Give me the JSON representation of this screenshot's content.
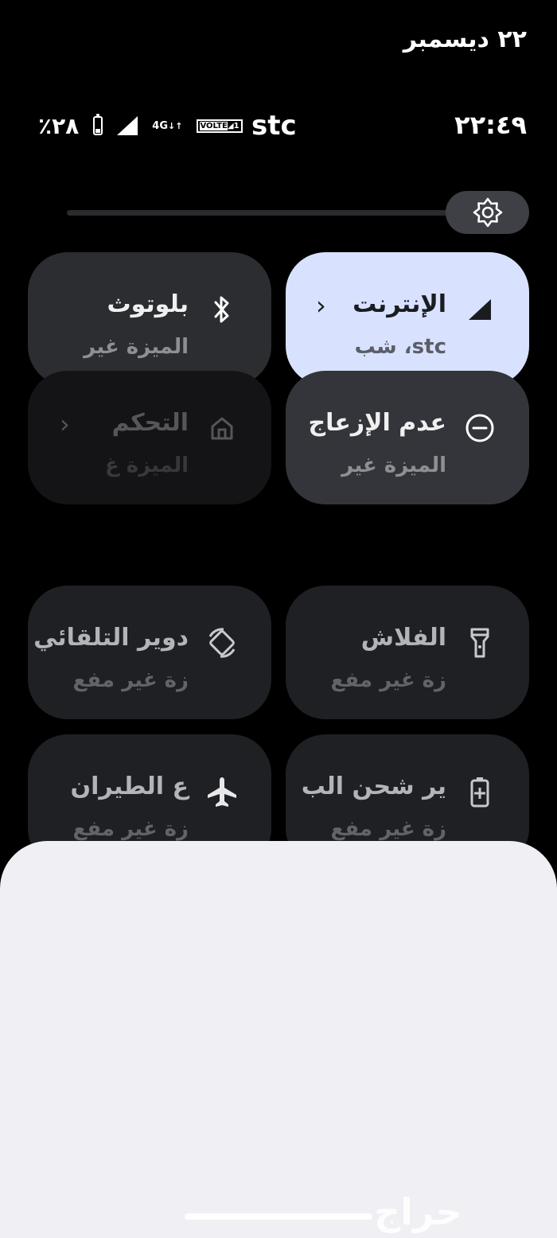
{
  "status_bar": {
    "date": "٢٢ ديسمبر",
    "time": "٢٢:٤٩",
    "carrier": "stc",
    "battery_percent": "٪٢٨",
    "battery_level": 0.28,
    "network": "4G",
    "volte": "VOLTE"
  },
  "brightness": {
    "level": 0.8,
    "icon": "brightness-icon"
  },
  "tiles": {
    "internet": {
      "label": "الإنترنت",
      "sub": "stc، شب",
      "icon": "signal-icon",
      "active": true
    },
    "bluetooth": {
      "label": "بلوتوث",
      "sub": "الميزة غير",
      "icon": "bluetooth-icon"
    },
    "dnd": {
      "label": "عدم الإزعاج",
      "sub": "الميزة غير",
      "icon": "dnd-icon"
    },
    "home_controls": {
      "label": "التحكم",
      "sub": "الميزة غ",
      "icon": "home-icon"
    },
    "flashlight": {
      "label": "الفلاش",
      "sub": "زة غير مفع",
      "icon": "flashlight-icon"
    },
    "auto_rotate": {
      "label": "دوير التلقائي",
      "sub": "زة غير مفع",
      "icon": "rotate-icon"
    },
    "battery_saver": {
      "label": "ير شحن الب",
      "sub": "زة غير مفع",
      "icon": "battery-saver-icon"
    },
    "airplane": {
      "label": "ع الطيران",
      "sub": "زة غير مفع",
      "icon": "airplane-icon"
    }
  },
  "watermark": "حراج"
}
